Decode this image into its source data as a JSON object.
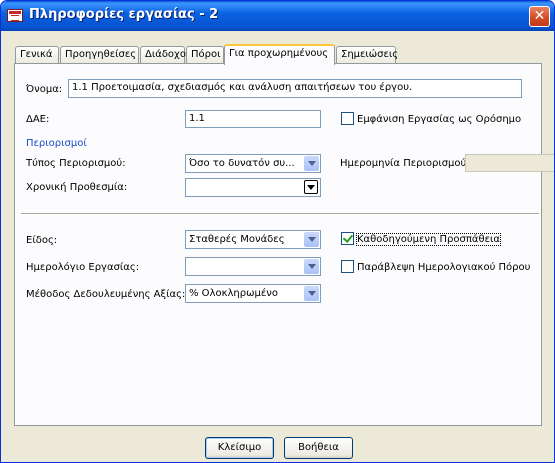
{
  "window": {
    "title": "Πληροφορίες εργασίας - 2",
    "close": "✕"
  },
  "tabs": [
    {
      "label": "Γενικά"
    },
    {
      "label": "Προηγηθείσες"
    },
    {
      "label": "Διάδοχοι"
    },
    {
      "label": "Πόροι"
    },
    {
      "label": "Για προχωρημένους"
    },
    {
      "label": "Σημειώσεις"
    }
  ],
  "active_tab": "Για προχωρημένους",
  "form": {
    "name_label": "Όνομα:",
    "name_value": "1.1 Προετοιμασία, σχεδιασμός και ανάλυση απαιτήσεων του έργου.",
    "wbs_label": "ΔΑΕ:",
    "wbs_value": "1.1",
    "milestone_label": "Εμφάνιση Εργασίας ως Ορόσημο",
    "milestone_checked": false,
    "constraints_section": "Περιορισμοί",
    "constraint_type_label": "Τύπος Περιορισμού:",
    "constraint_type_value": "Όσο το δυνατόν συ...",
    "constraint_date_label": "Ημερομηνία  Περιορισμού:",
    "constraint_date_value": "",
    "deadline_label": "Χρονική Προθεσμία:",
    "deadline_value": "",
    "type_label": "Είδος:",
    "type_value": "Σταθερές Μονάδες",
    "effort_driven_label": "Καθοδηγούμενη Προσπάθεια",
    "effort_driven_checked": true,
    "calendar_label": "Ημερολόγιο Εργασίας:",
    "calendar_value": "",
    "ignore_calendar_label": "Παράβλεψη Ημερολογιακού Πόρου",
    "ignore_calendar_checked": false,
    "earned_value_label": "Μέθοδος Δεδουλευμένης Αξίας:",
    "earned_value_value": "% Ολοκληρωμένο"
  },
  "buttons": {
    "close_label": "Κλείσιμο",
    "help_label": "Βοήθεια"
  },
  "colors": {
    "titlebar": "#0653d1",
    "section_header": "#1a4cc8",
    "background": "#ece9d8",
    "panel": "#fcfcfe"
  }
}
